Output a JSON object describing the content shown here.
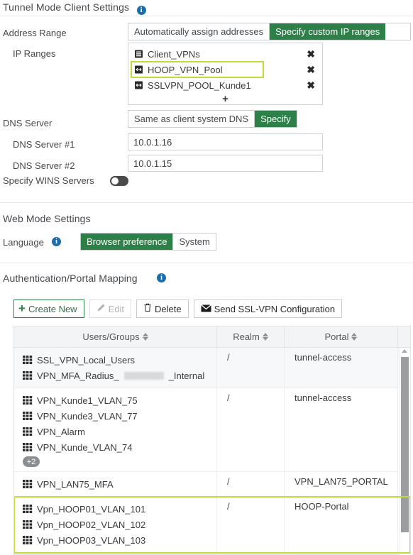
{
  "tunnel_section": {
    "title": "Tunnel Mode Client Settings",
    "info_icon": "info-icon",
    "address_range": {
      "label": "Address Range",
      "options": [
        "Automatically assign addresses",
        "Specify custom IP ranges"
      ],
      "selected": "Specify custom IP ranges"
    },
    "ip_ranges": {
      "label": "IP Ranges",
      "items": [
        {
          "name": "Client_VPNs",
          "icon": "address-object-icon",
          "selected": false,
          "remove_icon": "close-icon"
        },
        {
          "name": "HOOP_VPN_Pool",
          "icon": "ip-range-icon",
          "selected": true,
          "remove_icon": "close-icon"
        },
        {
          "name": "SSLVPN_POOL_Kunde1",
          "icon": "ip-range-icon",
          "selected": false,
          "remove_icon": "close-icon"
        }
      ],
      "add_label": "+"
    },
    "dns_server": {
      "label": "DNS Server",
      "options": [
        "Same as client system DNS",
        "Specify"
      ],
      "selected": "Specify"
    },
    "dns1": {
      "label": "DNS Server #1",
      "value": "10.0.1.16"
    },
    "dns2": {
      "label": "DNS Server #2",
      "value": "10.0.1.15"
    },
    "wins": {
      "label": "Specify WINS Servers",
      "enabled": false
    }
  },
  "web_mode": {
    "title": "Web Mode Settings",
    "language": {
      "label": "Language",
      "info_icon": "info-icon",
      "options": [
        "Browser preference",
        "System"
      ],
      "selected": "Browser preference"
    }
  },
  "auth_portal": {
    "title": "Authentication/Portal Mapping",
    "info_icon": "info-icon",
    "toolbar": [
      {
        "label": "Create New",
        "icon": "plus-icon",
        "style": "create",
        "disabled": false
      },
      {
        "label": "Edit",
        "icon": "pencil-icon",
        "style": "plain",
        "disabled": true
      },
      {
        "label": "Delete",
        "icon": "trash-icon",
        "style": "plain",
        "disabled": false
      },
      {
        "label": "Send SSL-VPN Configuration",
        "icon": "envelope-icon",
        "style": "plain",
        "disabled": false
      }
    ],
    "columns": [
      {
        "label": "Users/Groups",
        "sortable": true
      },
      {
        "label": "Realm",
        "sortable": true
      },
      {
        "label": "Portal",
        "sortable": true
      }
    ],
    "rows": [
      {
        "users": [
          {
            "name": "SSL_VPN_Local_Users",
            "icon": "user-group-icon",
            "redacted": false
          },
          {
            "name_before": "VPN_MFA_Radius_",
            "name_after": "_Internal",
            "icon": "user-group-icon",
            "redacted": true
          }
        ],
        "realm": "/",
        "portal": "tunnel-access",
        "extra": null,
        "highlighted": false,
        "alt": true
      },
      {
        "users": [
          {
            "name": "VPN_Kunde1_VLAN_75",
            "icon": "user-group-icon",
            "redacted": false
          },
          {
            "name": "VPN_Kunde3_VLAN_77",
            "icon": "user-group-icon",
            "redacted": false
          },
          {
            "name": "VPN_Alarm",
            "icon": "user-group-icon",
            "redacted": false
          },
          {
            "name": "VPN_Kunde_VLAN_74",
            "icon": "user-group-icon",
            "redacted": false
          }
        ],
        "realm": "/",
        "portal": "tunnel-access",
        "extra": "+2",
        "highlighted": false,
        "alt": false
      },
      {
        "users": [
          {
            "name": "VPN_LAN75_MFA",
            "icon": "user-group-icon",
            "redacted": false
          }
        ],
        "realm": "/",
        "portal": "VPN_LAN75_PORTAL",
        "extra": null,
        "highlighted": false,
        "alt": false
      },
      {
        "users": [
          {
            "name": "Vpn_HOOP01_VLAN_101",
            "icon": "user-group-icon",
            "redacted": false
          },
          {
            "name": "Vpn_HOOP02_VLAN_102",
            "icon": "user-group-icon",
            "redacted": false
          },
          {
            "name": "Vpn_HOOP03_VLAN_103",
            "icon": "user-group-icon",
            "redacted": false
          }
        ],
        "realm": "/",
        "portal": "HOOP-Portal",
        "extra": null,
        "highlighted": true,
        "alt": false
      }
    ],
    "scrollbar": {
      "arrow_icon": "caret-up-icon"
    }
  },
  "colors": {
    "accent_green": "#2e8049",
    "highlight_yellow": "#c3d93c",
    "info_blue": "#1b6ea8",
    "badge_grey": "#8b8f92"
  }
}
